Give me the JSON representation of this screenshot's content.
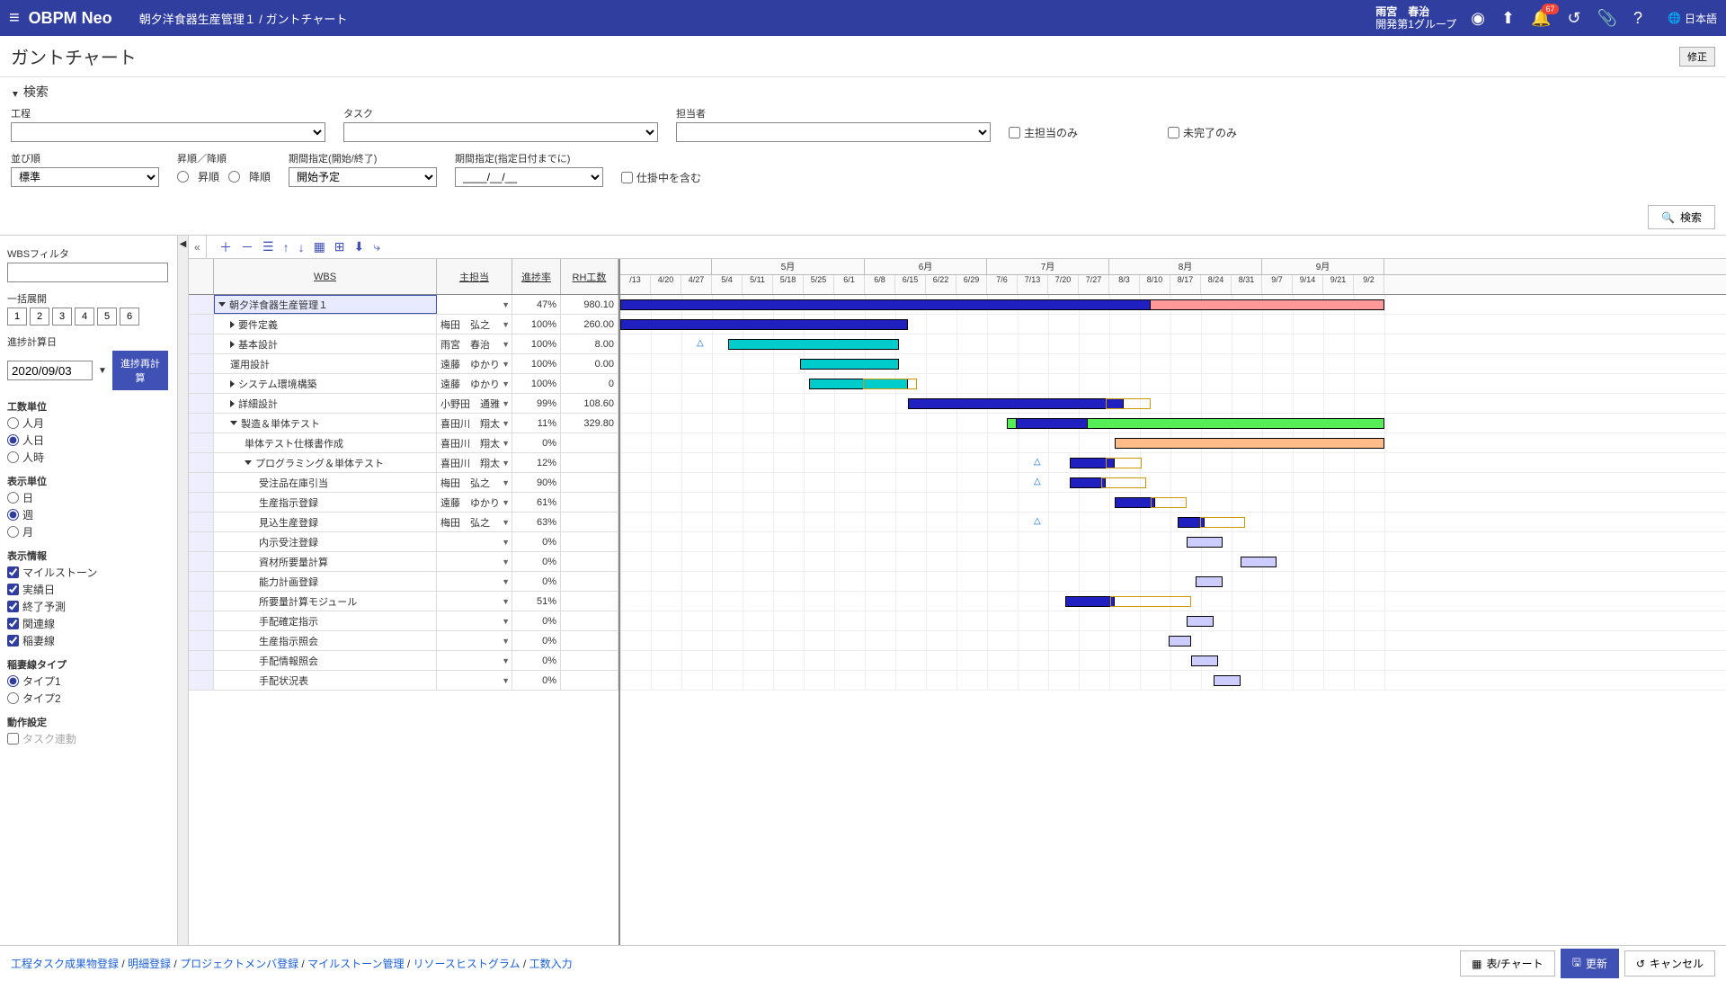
{
  "header": {
    "logo": "OBPM Neo",
    "breadcrumb": "朝夕洋食器生産管理１ / ガントチャート",
    "user_name": "雨宮　春治",
    "user_group": "開発第1グループ",
    "badge": "67",
    "lang": "日本語"
  },
  "page": {
    "title": "ガントチャート",
    "fix_btn": "修正"
  },
  "search": {
    "head": "検索",
    "labels": {
      "process": "工程",
      "task": "タスク",
      "owner": "担当者",
      "main_only": "主担当のみ",
      "incomplete_only": "未完了のみ",
      "sort": "並び順",
      "asc_desc": "昇順／降順",
      "asc": "昇順",
      "desc": "降順",
      "period_type": "期間指定(開始/終了)",
      "period_until": "期間指定(指定日付までに)",
      "include_wip": "仕掛中を含む"
    },
    "sort_value": "標準",
    "period_type_value": "開始予定",
    "period_until_value": "____/__/__",
    "search_btn": "検索"
  },
  "left": {
    "wbs_filter": "WBSフィルタ",
    "expand_all": "一括展開",
    "levels": [
      "1",
      "2",
      "3",
      "4",
      "5",
      "6"
    ],
    "calc_date_label": "進捗計算日",
    "calc_date": "2020/09/03",
    "recalc_btn": "進捗再計算",
    "effort_unit": {
      "title": "工数単位",
      "opts": [
        "人月",
        "人日",
        "人時"
      ],
      "sel": "人日"
    },
    "disp_unit": {
      "title": "表示単位",
      "opts": [
        "日",
        "週",
        "月"
      ],
      "sel": "週"
    },
    "disp_info": {
      "title": "表示情報",
      "opts": [
        "マイルストーン",
        "実績日",
        "終了予測",
        "関連線",
        "稲妻線"
      ]
    },
    "inazuma": {
      "title": "稲妻線タイプ",
      "opts": [
        "タイプ1",
        "タイプ2"
      ],
      "sel": "タイプ1"
    },
    "action": {
      "title": "動作設定",
      "opt": "タスク連動"
    }
  },
  "grid": {
    "headers": {
      "wbs": "WBS",
      "owner": "主担当",
      "prog": "進捗率",
      "rh": "RH工数"
    },
    "rows": [
      {
        "lvl": 0,
        "exp": "down",
        "name": "朝夕洋食器生産管理１",
        "owner": "",
        "prog": "47%",
        "rh": "980.10",
        "hl": true
      },
      {
        "lvl": 1,
        "exp": "right",
        "name": "要件定義",
        "owner": "梅田　弘之",
        "prog": "100%",
        "rh": "260.00"
      },
      {
        "lvl": 1,
        "exp": "right",
        "name": "基本設計",
        "owner": "雨宮　春治",
        "prog": "100%",
        "rh": "8.00"
      },
      {
        "lvl": 1,
        "exp": "",
        "name": "運用設計",
        "owner": "遠藤　ゆかり",
        "prog": "100%",
        "rh": "0.00"
      },
      {
        "lvl": 1,
        "exp": "right",
        "name": "システム環境構築",
        "owner": "遠藤　ゆかり",
        "prog": "100%",
        "rh": "0"
      },
      {
        "lvl": 1,
        "exp": "right",
        "name": "詳細設計",
        "owner": "小野田　通雅",
        "prog": "99%",
        "rh": "108.60"
      },
      {
        "lvl": 1,
        "exp": "down",
        "name": "製造＆単体テスト",
        "owner": "喜田川　翔太",
        "prog": "11%",
        "rh": "329.80"
      },
      {
        "lvl": 2,
        "exp": "",
        "name": "単体テスト仕様書作成",
        "owner": "喜田川　翔太",
        "prog": "0%",
        "rh": ""
      },
      {
        "lvl": 2,
        "exp": "down",
        "name": "プログラミング＆単体テスト",
        "owner": "喜田川　翔太",
        "prog": "12%",
        "rh": ""
      },
      {
        "lvl": 3,
        "exp": "",
        "name": "受注品在庫引当",
        "owner": "梅田　弘之",
        "prog": "90%",
        "rh": ""
      },
      {
        "lvl": 3,
        "exp": "",
        "name": "生産指示登録",
        "owner": "遠藤　ゆかり",
        "prog": "61%",
        "rh": ""
      },
      {
        "lvl": 3,
        "exp": "",
        "name": "見込生産登録",
        "owner": "梅田　弘之",
        "prog": "63%",
        "rh": ""
      },
      {
        "lvl": 3,
        "exp": "",
        "name": "内示受注登録",
        "owner": "",
        "prog": "0%",
        "rh": ""
      },
      {
        "lvl": 3,
        "exp": "",
        "name": "資材所要量計算",
        "owner": "",
        "prog": "0%",
        "rh": ""
      },
      {
        "lvl": 3,
        "exp": "",
        "name": "能力計画登録",
        "owner": "",
        "prog": "0%",
        "rh": ""
      },
      {
        "lvl": 3,
        "exp": "",
        "name": "所要量計算モジュール",
        "owner": "",
        "prog": "51%",
        "rh": ""
      },
      {
        "lvl": 3,
        "exp": "",
        "name": "手配確定指示",
        "owner": "",
        "prog": "0%",
        "rh": ""
      },
      {
        "lvl": 3,
        "exp": "",
        "name": "生産指示照会",
        "owner": "",
        "prog": "0%",
        "rh": ""
      },
      {
        "lvl": 3,
        "exp": "",
        "name": "手配情報照会",
        "owner": "",
        "prog": "0%",
        "rh": ""
      },
      {
        "lvl": 3,
        "exp": "",
        "name": "手配状況表",
        "owner": "",
        "prog": "0%",
        "rh": ""
      }
    ]
  },
  "timeline": {
    "months": [
      {
        "label": "5月",
        "span": 5
      },
      {
        "label": "6月",
        "span": 4
      },
      {
        "label": "7月",
        "span": 4
      },
      {
        "label": "8月",
        "span": 5
      },
      {
        "label": "9月",
        "span": 4
      }
    ],
    "weeks": [
      "/13",
      "4/20",
      "4/27",
      "5/4",
      "5/11",
      "5/18",
      "5/25",
      "6/1",
      "6/8",
      "6/15",
      "6/22",
      "6/29",
      "7/6",
      "7/13",
      "7/20",
      "7/27",
      "8/3",
      "8/10",
      "8/17",
      "8/24",
      "8/31",
      "9/7",
      "9/14",
      "9/21",
      "9/2"
    ]
  },
  "footer": {
    "links": [
      "工程タスク成果物登録",
      "明細登録",
      "プロジェクトメンバ登録",
      "マイルストーン管理",
      "リソースヒストグラム",
      "工数入力"
    ],
    "table_chart": "表/チャート",
    "update": "更新",
    "cancel": "キャンセル"
  }
}
